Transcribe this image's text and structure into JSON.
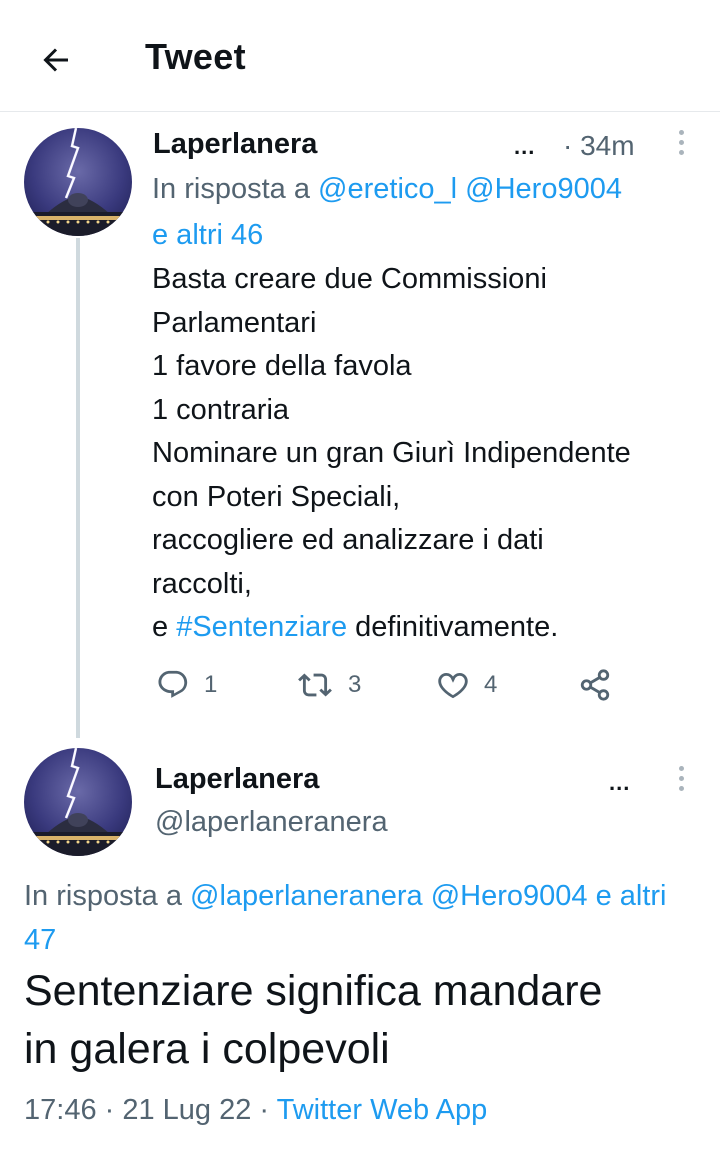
{
  "header": {
    "title": "Tweet"
  },
  "tweet1": {
    "name": "Laperlanera",
    "more": "...",
    "time": "· 34m",
    "reply_prefix": "In risposta a ",
    "reply_mention1": "@eretico_l",
    "reply_mention2": "@Hero9004",
    "reply_others": "e altri 46",
    "text_lines": [
      "Basta creare due Commissioni",
      "Parlamentari",
      "1 favore della favola",
      "1 contraria",
      "Nominare un gran Giurì Indipendente",
      "con Poteri Speciali,",
      "raccogliere ed analizzare i dati",
      "raccolti,"
    ],
    "last_line_prefix": "e ",
    "hashtag": "#Sentenziare",
    "last_line_suffix": " definitivamente.",
    "reply_count": "1",
    "retweet_count": "3",
    "like_count": "4"
  },
  "tweet2": {
    "name": "Laperlanera",
    "more": "...",
    "handle": "@laperlaneranera",
    "reply_prefix": "In risposta a ",
    "reply_mention1": "@laperlaneranera",
    "reply_mention2": "@Hero9004",
    "reply_others": "e altri 47",
    "text_line1": "Sentenziare significa mandare",
    "text_line2": "in galera i colpevoli",
    "timestamp": "17:46 · 21 Lug 22 · ",
    "source": "Twitter Web App"
  },
  "colors": {
    "accent": "#1d9bf0",
    "secondary_text": "#536471",
    "primary_text": "#0f1419"
  },
  "icons": [
    "back-arrow-icon",
    "reply-icon",
    "retweet-icon",
    "like-icon",
    "share-icon",
    "kebab-icon"
  ]
}
